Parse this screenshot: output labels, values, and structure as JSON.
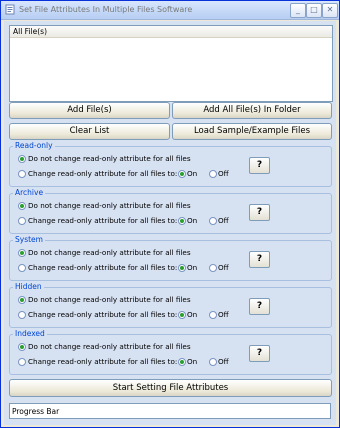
{
  "window": {
    "title": "Set File Attributes In Multiple Files Software",
    "minimize": "_",
    "maximize": "□",
    "close": "✕"
  },
  "files": {
    "header": "All File(s)"
  },
  "buttons": {
    "add_files": "Add File(s)",
    "add_folder": "Add All File(s) In Folder",
    "clear_list": "Clear List",
    "load_sample": "Load Sample/Example Files",
    "start": "Start Setting File Attributes"
  },
  "groups": [
    {
      "title": "Read-only",
      "opt1": "Do not change read-only attribute for all files",
      "opt2": "Change read-only attribute for all files to:",
      "on": "On",
      "off": "Off",
      "help": "?"
    },
    {
      "title": "Archive",
      "opt1": "Do not change read-only attribute for all files",
      "opt2": "Change read-only attribute for all files to:",
      "on": "On",
      "off": "Off",
      "help": "?"
    },
    {
      "title": "System",
      "opt1": "Do not change read-only attribute for all files",
      "opt2": "Change read-only attribute for all files to:",
      "on": "On",
      "off": "Off",
      "help": "?"
    },
    {
      "title": "Hidden",
      "opt1": "Do not change read-only attribute for all files",
      "opt2": "Change read-only attribute for all files to:",
      "on": "On",
      "off": "Off",
      "help": "?"
    },
    {
      "title": "Indexed",
      "opt1": "Do not change read-only attribute for all files",
      "opt2": "Change read-only attribute for all files to:",
      "on": "On",
      "off": "Off",
      "help": "?"
    }
  ],
  "progress": {
    "label": "Progress Bar"
  }
}
